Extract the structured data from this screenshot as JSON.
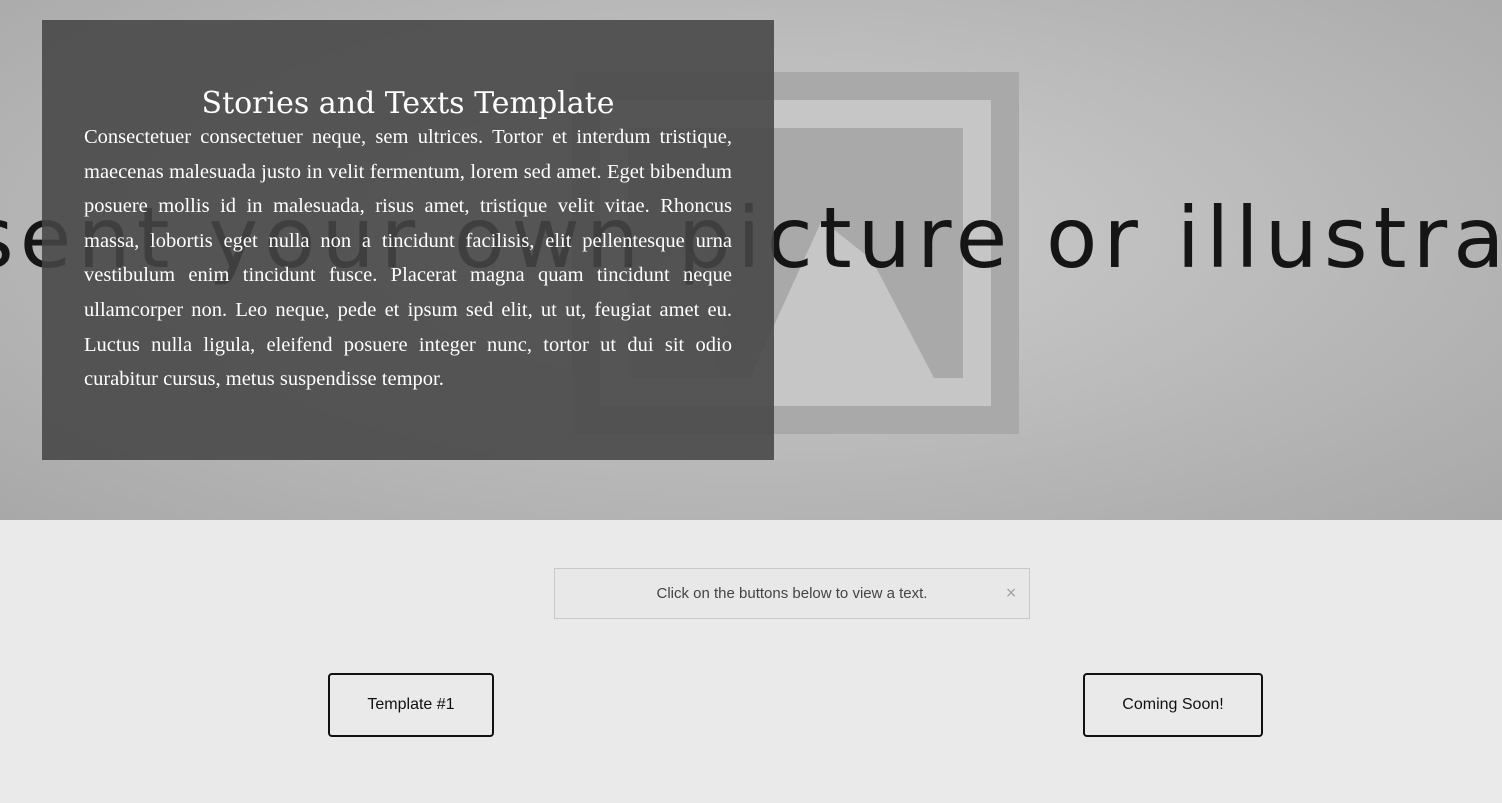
{
  "hero": {
    "overlay_text": "sent your own picture or illustrat"
  },
  "panel": {
    "title": "Stories and Texts Template",
    "body": "Consectetuer consectetuer neque, sem ultrices. Tortor et interdum tristique, maecenas malesuada justo in velit fermentum, lorem sed amet. Eget bibendum posuere mollis id in malesuada, risus amet, tristique velit vitae. Rhoncus massa, lobortis eget nulla non a tincidunt facilisis, elit pellentesque urna vestibulum enim tincidunt fusce. Placerat magna quam tincidunt neque ullamcorper non. Leo neque, pede et ipsum sed elit, ut ut, feugiat amet eu. Luctus nulla ligula, eleifend posuere integer nunc, tortor ut dui sit odio curabitur cursus, metus suspendisse tempor."
  },
  "notice": {
    "text": "Click on the buttons below to view a text.",
    "close_glyph": "×"
  },
  "buttons": {
    "template_label": "Template #1",
    "coming_label": "Coming Soon!"
  },
  "colors": {
    "page_background": "#eaeaea",
    "panel_background": "#464646",
    "text_light": "#ffffff",
    "button_border": "#111111"
  }
}
